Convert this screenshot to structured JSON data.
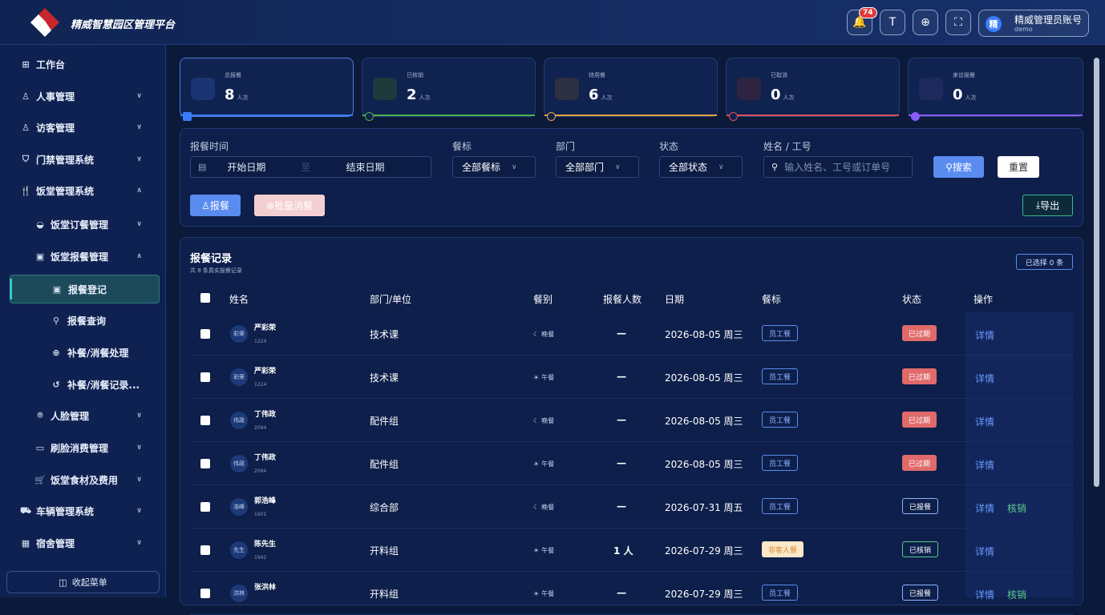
{
  "app": {
    "title": "精威智慧园区管理平台",
    "notification_count": "74",
    "user_name": "精威管理员账号",
    "user_sub": "demo",
    "user_initial": "精"
  },
  "sidebar": {
    "items": [
      {
        "label": "工作台",
        "icon": "grid-icon"
      },
      {
        "label": "人事管理",
        "icon": "users-icon"
      },
      {
        "label": "访客管理",
        "icon": "visitor-icon"
      },
      {
        "label": "门禁管理系统",
        "icon": "shield-icon"
      },
      {
        "label": "饭堂管理系统",
        "icon": "fork-knife-icon"
      },
      {
        "label": "饭堂订餐管理",
        "icon": "bowl-icon"
      },
      {
        "label": "饭堂报餐管理",
        "icon": "clipboard-icon"
      },
      {
        "label": "报餐登记",
        "icon": "clipboard-check-icon"
      },
      {
        "label": "报餐查询",
        "icon": "search-icon"
      },
      {
        "label": "补餐/消餐处理",
        "icon": "plus-circle-icon"
      },
      {
        "label": "补餐/消餐记录...",
        "icon": "history-icon"
      },
      {
        "label": "人脸管理",
        "icon": "face-icon"
      },
      {
        "label": "刷脸消费管理",
        "icon": "wallet-icon"
      },
      {
        "label": "饭堂食材及费用",
        "icon": "cart-icon"
      },
      {
        "label": "车辆管理系统",
        "icon": "car-icon"
      },
      {
        "label": "宿舍管理",
        "icon": "building-icon"
      }
    ],
    "collapse_label": "收起菜单"
  },
  "stats": [
    {
      "label": "总报餐",
      "value": "8",
      "unit": "人次",
      "color": "#3b7cff"
    },
    {
      "label": "已核销",
      "value": "2",
      "unit": "人次",
      "color": "#4caf50"
    },
    {
      "label": "待用餐",
      "value": "6",
      "unit": "人次",
      "color": "#e8a33d"
    },
    {
      "label": "已取消",
      "value": "0",
      "unit": "人次",
      "color": "#e0505a"
    },
    {
      "label": "来访报餐",
      "value": "0",
      "unit": "人次",
      "color": "#8b5cf6"
    }
  ],
  "filters": {
    "time_label": "报餐时间",
    "start_placeholder": "开始日期",
    "to": "至",
    "end_placeholder": "结束日期",
    "meal_label": "餐标",
    "meal_value": "全部餐标",
    "dept_label": "部门",
    "dept_value": "全部部门",
    "status_label": "状态",
    "status_value": "全部状态",
    "name_label": "姓名 / 工号",
    "name_placeholder": "输入姓名、工号或订单号",
    "search_btn": "搜索",
    "reset_btn": "重置"
  },
  "actions": {
    "report_btn": "报餐",
    "batch_cancel_btn": "批量消餐",
    "export_btn": "导出"
  },
  "records": {
    "title": "报餐记录",
    "subtitle": "共 8 条真实报餐记录",
    "selected": "已选择 0 条",
    "columns": [
      "姓名",
      "部门/单位",
      "餐别",
      "报餐人数",
      "日期",
      "餐标",
      "状态",
      "操作"
    ],
    "rows": [
      {
        "avatar": "彩荣",
        "name": "严彩荣",
        "id": "1224",
        "dept": "技术课",
        "meal": "晚餐",
        "count": "—",
        "date": "2026-08-05 周三",
        "standard": "员工餐",
        "status": "已过期",
        "op1": "详情",
        "op2": ""
      },
      {
        "avatar": "彩荣",
        "name": "严彩荣",
        "id": "1224",
        "dept": "技术课",
        "meal": "午餐",
        "count": "—",
        "date": "2026-08-05 周三",
        "standard": "员工餐",
        "status": "已过期",
        "op1": "详情",
        "op2": ""
      },
      {
        "avatar": "伟政",
        "name": "丁伟政",
        "id": "2094",
        "dept": "配件组",
        "meal": "晚餐",
        "count": "—",
        "date": "2026-08-05 周三",
        "standard": "员工餐",
        "status": "已过期",
        "op1": "详情",
        "op2": ""
      },
      {
        "avatar": "伟政",
        "name": "丁伟政",
        "id": "2094",
        "dept": "配件组",
        "meal": "午餐",
        "count": "—",
        "date": "2026-08-05 周三",
        "standard": "员工餐",
        "status": "已过期",
        "op1": "详情",
        "op2": ""
      },
      {
        "avatar": "浩峰",
        "name": "郭浩峰",
        "id": "1601",
        "dept": "综合部",
        "meal": "晚餐",
        "count": "—",
        "date": "2026-07-31 周五",
        "standard": "员工餐",
        "status": "已报餐",
        "op1": "详情",
        "op2": "核销"
      },
      {
        "avatar": "先生",
        "name": "陈先生",
        "id": "1942",
        "dept": "开料组",
        "meal": "午餐",
        "count": "1 人",
        "date": "2026-07-29 周三",
        "standard": "非客人餐",
        "status": "已核销",
        "op1": "详情",
        "op2": ""
      },
      {
        "avatar": "洪林",
        "name": "张洪林",
        "id": "",
        "dept": "开料组",
        "meal": "午餐",
        "count": "—",
        "date": "2026-07-29 周三",
        "standard": "员工餐",
        "status": "已报餐",
        "op1": "详情",
        "op2": "核销"
      }
    ]
  }
}
